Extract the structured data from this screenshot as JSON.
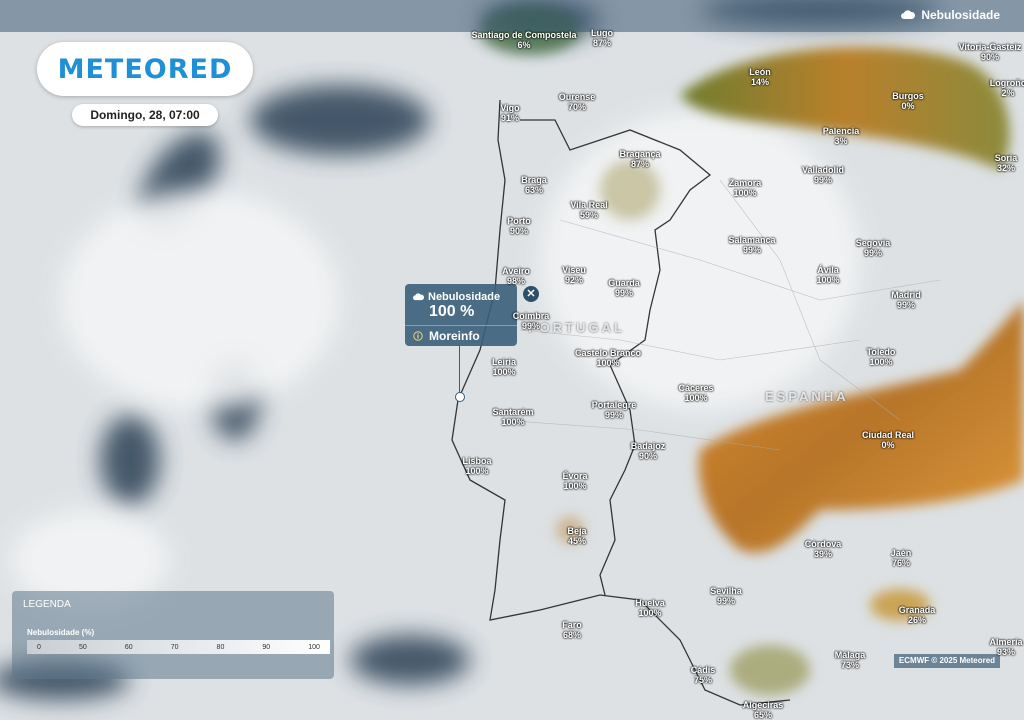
{
  "header": {
    "layer_label": "Nebulosidade",
    "layer_icon": "cloud-icon"
  },
  "brand": {
    "logo_text": "METEORED",
    "color": "#1f8fd6"
  },
  "date_label": "Domingo, 28, 07:00",
  "popup": {
    "title": "Nebulosidade",
    "value": "100 %",
    "more_label": "Moreinfo",
    "close_icon": "close-icon"
  },
  "legend": {
    "title": "LEGENDA",
    "subtitle": "Nebulosidade (%)",
    "ticks": [
      "0",
      "50",
      "60",
      "70",
      "80",
      "90",
      "100"
    ]
  },
  "credit": "ECMWF © 2025 Meteored",
  "countries": {
    "portugal": "PORTUGAL",
    "spain": "ESPANHA"
  },
  "cities": [
    {
      "name": "Santiago de Compostela",
      "value": "6%"
    },
    {
      "name": "Lugo",
      "value": "87%"
    },
    {
      "name": "Ourense",
      "value": "70%"
    },
    {
      "name": "Vigo",
      "value": "91%"
    },
    {
      "name": "León",
      "value": "14%"
    },
    {
      "name": "Burgos",
      "value": "0%"
    },
    {
      "name": "Vitoria-Gasteiz",
      "value": "90%"
    },
    {
      "name": "Logroño",
      "value": "2%"
    },
    {
      "name": "Palencia",
      "value": "3%"
    },
    {
      "name": "Soria",
      "value": "32%"
    },
    {
      "name": "Braga",
      "value": "63%"
    },
    {
      "name": "Bragança",
      "value": "87%"
    },
    {
      "name": "Vila Real",
      "value": "59%"
    },
    {
      "name": "Zamora",
      "value": "100%"
    },
    {
      "name": "Valladolid",
      "value": "99%"
    },
    {
      "name": "Porto",
      "value": "90%"
    },
    {
      "name": "Salamanca",
      "value": "99%"
    },
    {
      "name": "Segovia",
      "value": "99%"
    },
    {
      "name": "Aveiro",
      "value": "98%"
    },
    {
      "name": "Viseu",
      "value": "92%"
    },
    {
      "name": "Guarda",
      "value": "99%"
    },
    {
      "name": "Ávila",
      "value": "100%"
    },
    {
      "name": "Madrid",
      "value": "99%"
    },
    {
      "name": "Coimbra",
      "value": "99%"
    },
    {
      "name": "Castelo Branco",
      "value": "100%"
    },
    {
      "name": "Toledo",
      "value": "100%"
    },
    {
      "name": "Leiria",
      "value": "100%"
    },
    {
      "name": "Cáceres",
      "value": "100%"
    },
    {
      "name": "Santarém",
      "value": "100%"
    },
    {
      "name": "Portalegre",
      "value": "99%"
    },
    {
      "name": "Ciudad Real",
      "value": "0%"
    },
    {
      "name": "Badajoz",
      "value": "90%"
    },
    {
      "name": "Lisboa",
      "value": "100%"
    },
    {
      "name": "Évora",
      "value": "100%"
    },
    {
      "name": "Beja",
      "value": "45%"
    },
    {
      "name": "Córdova",
      "value": "39%"
    },
    {
      "name": "Jaén",
      "value": "76%"
    },
    {
      "name": "Sevilha",
      "value": "99%"
    },
    {
      "name": "Huelva",
      "value": "100%"
    },
    {
      "name": "Granada",
      "value": "26%"
    },
    {
      "name": "Faro",
      "value": "68%"
    },
    {
      "name": "Málaga",
      "value": "73%"
    },
    {
      "name": "Almería",
      "value": "93%"
    },
    {
      "name": "Cádis",
      "value": "75%"
    },
    {
      "name": "Algeciras",
      "value": "65%"
    }
  ]
}
